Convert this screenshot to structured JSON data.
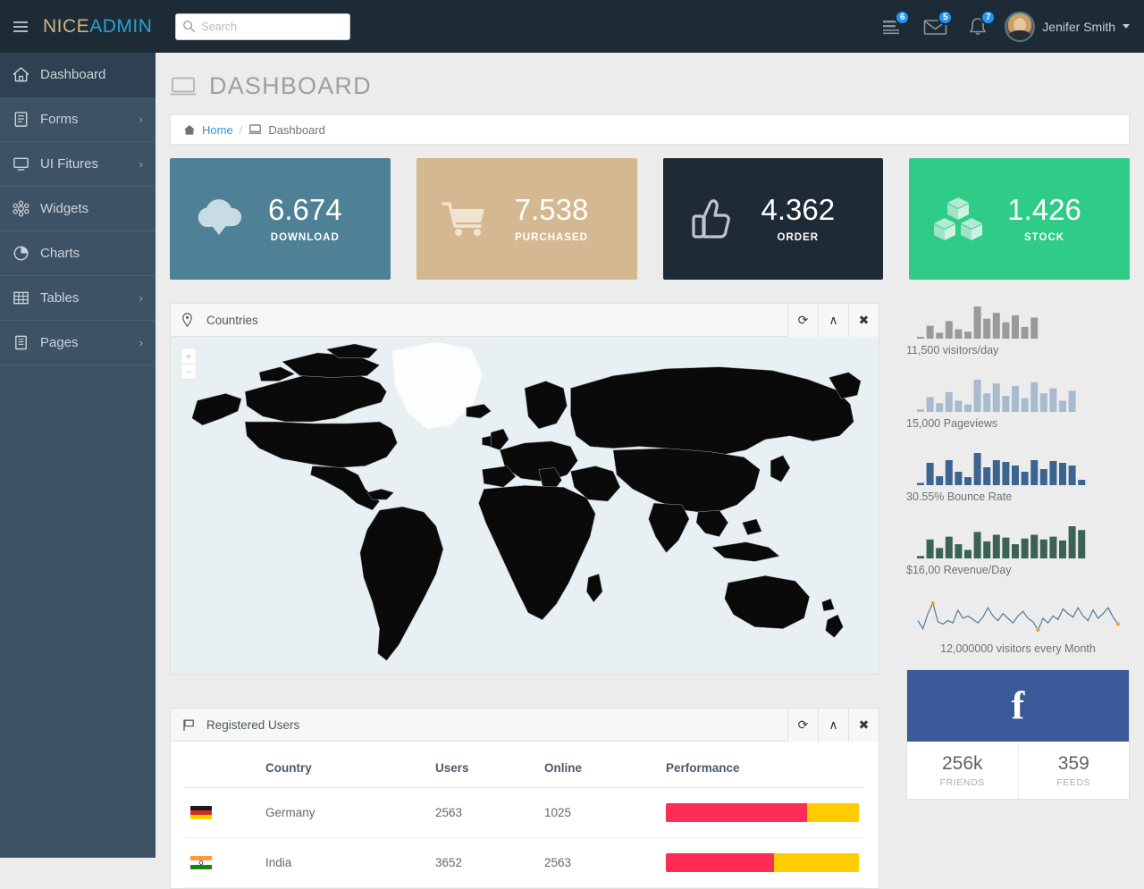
{
  "topbar": {
    "brand_first": "NICE",
    "brand_second": "ADMIN",
    "search_placeholder": "Search",
    "search_value": "",
    "tasks_badge": "6",
    "messages_badge": "5",
    "alerts_badge": "7",
    "user_name": "Jenifer Smith"
  },
  "sidebar": {
    "items": [
      {
        "label": "Dashboard",
        "icon": "home-icon",
        "has_chevron": false,
        "active": true
      },
      {
        "label": "Forms",
        "icon": "form-icon",
        "has_chevron": true,
        "active": false
      },
      {
        "label": "UI Fitures",
        "icon": "monitor-icon",
        "has_chevron": true,
        "active": false
      },
      {
        "label": "Widgets",
        "icon": "widgets-icon",
        "has_chevron": false,
        "active": false
      },
      {
        "label": "Charts",
        "icon": "pie-chart-icon",
        "has_chevron": false,
        "active": false
      },
      {
        "label": "Tables",
        "icon": "table-icon",
        "has_chevron": true,
        "active": false
      },
      {
        "label": "Pages",
        "icon": "pages-icon",
        "has_chevron": true,
        "active": false
      }
    ],
    "chevron_glyph": "›"
  },
  "page": {
    "title": "DASHBOARD",
    "breadcrumb_home": "Home",
    "breadcrumb_sep": "/",
    "breadcrumb_current": "Dashboard"
  },
  "stat_cards": [
    {
      "value": "6.674",
      "label": "DOWNLOAD",
      "color": "#4E8195",
      "icon": "cloud-download-icon"
    },
    {
      "value": "7.538",
      "label": "PURCHASED",
      "color": "#D4B891",
      "icon": "shopping-cart-icon"
    },
    {
      "value": "4.362",
      "label": "ORDER",
      "color": "#1E2B36",
      "icon": "thumbs-up-icon"
    },
    {
      "value": "1.426",
      "label": "STOCK",
      "color": "#2ECC87",
      "icon": "boxes-icon"
    }
  ],
  "countries_panel": {
    "title": "Countries",
    "icon": "map-marker-icon",
    "refresh_glyph": "⟳",
    "collapse_glyph": "∧",
    "close_glyph": "✖",
    "zoom_in": "+",
    "zoom_out": "−"
  },
  "registered_users_panel": {
    "title": "Registered Users",
    "icon": "flag-icon",
    "refresh_glyph": "⟳",
    "collapse_glyph": "∧",
    "close_glyph": "✖",
    "columns": [
      "",
      "Country",
      "Users",
      "Online",
      "Performance"
    ],
    "rows": [
      {
        "flag": "germany-flag",
        "country": "Germany",
        "users": "2563",
        "online": "1025",
        "performance": 73
      },
      {
        "flag": "india-flag",
        "country": "India",
        "users": "3652",
        "online": "2563",
        "performance": 56
      }
    ]
  },
  "sparklines": [
    {
      "caption": "11,500 visitors/day",
      "type": "bar",
      "color": "#9A9A9A",
      "values": [
        3,
        22,
        10,
        30,
        16,
        12,
        55,
        34,
        44,
        28,
        40,
        20,
        36
      ]
    },
    {
      "caption": "15,000 Pageviews",
      "type": "bar",
      "color": "#A8BACD",
      "values": [
        4,
        24,
        14,
        32,
        18,
        12,
        52,
        30,
        46,
        26,
        42,
        22,
        48,
        30,
        38,
        18,
        34
      ]
    },
    {
      "caption": "30.55% Bounce Rate",
      "type": "bar",
      "color": "#3C6490",
      "values": [
        5,
        50,
        20,
        56,
        30,
        18,
        72,
        40,
        56,
        52,
        44,
        30,
        56,
        36,
        54,
        50,
        44,
        12
      ]
    },
    {
      "caption": "$16,00 Revenue/Day",
      "type": "bar",
      "color": "#3B6352",
      "values": [
        5,
        40,
        22,
        46,
        30,
        18,
        56,
        36,
        50,
        44,
        30,
        42,
        50,
        40,
        46,
        38,
        68,
        60
      ]
    },
    {
      "caption": "12,000000 visitors every Month",
      "type": "line",
      "color": "#4E7C99",
      "marker_color": "#F0A030",
      "values": [
        22,
        8,
        34,
        52,
        20,
        16,
        22,
        18,
        40,
        26,
        30,
        24,
        18,
        28,
        44,
        30,
        22,
        34,
        26,
        18,
        30,
        38,
        26,
        20,
        6,
        26,
        18,
        30,
        24,
        42,
        34,
        28,
        44,
        30,
        22,
        40,
        26,
        34,
        44,
        28,
        16
      ]
    }
  ],
  "facebook_widget": {
    "logo": "f",
    "friends_value": "256k",
    "friends_label": "FRIENDS",
    "feeds_value": "359",
    "feeds_label": "FEEDS"
  },
  "colors": {
    "topbar_bg": "#1C2B36",
    "sidebar_bg": "#3E5265",
    "sidebar_active": "#2F4052",
    "accent_blue": "#2196F3",
    "link_blue": "#3E8CD6",
    "facebook_blue": "#3B5998",
    "progress_red": "#FF2D55",
    "progress_yellow": "#FFCC00",
    "map_bg": "#E9F0F3",
    "map_land": "#0A0A0A"
  }
}
